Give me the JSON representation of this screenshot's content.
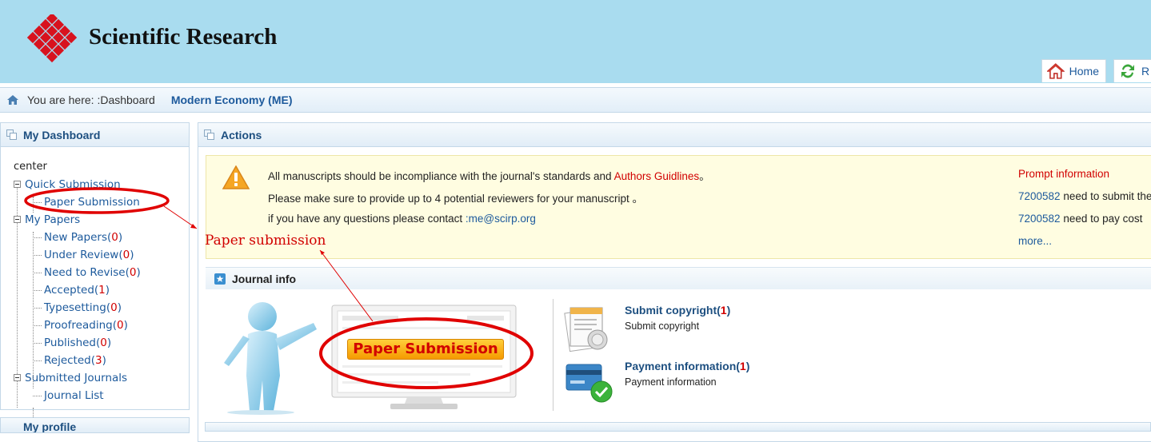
{
  "header": {
    "brand": "Scientific Research",
    "home_label": "Home",
    "refresh_label": "R"
  },
  "breadcrumb": {
    "prefix": "You are here: :Dashboard",
    "journal": "Modern Economy (ME)"
  },
  "sidebar": {
    "title": "My Dashboard",
    "root": "center",
    "quick_submission": "Quick Submission",
    "paper_submission": "Paper Submission",
    "my_papers": "My Papers",
    "papers": [
      {
        "label": "New Papers",
        "count": "0"
      },
      {
        "label": "Under Review",
        "count": "0"
      },
      {
        "label": "Need to Revise",
        "count": "0"
      },
      {
        "label": "Accepted",
        "count": "1"
      },
      {
        "label": "Typesetting",
        "count": "0"
      },
      {
        "label": "Proofreading",
        "count": "0"
      },
      {
        "label": "Published",
        "count": "0"
      },
      {
        "label": "Rejected",
        "count": "3"
      }
    ],
    "submitted_journals": "Submitted Journals",
    "journal_list": "Journal List",
    "second_panel_title": "My profile"
  },
  "actions": {
    "title": "Actions",
    "line1_prefix": "All manuscripts should be incompliance with the journal's standards and ",
    "line1_link": "Authors Guidlines",
    "line1_suffix": "。",
    "line2": "Please make sure to provide up to 4 potential reviewers for your manuscript 。",
    "line3_prefix": "if you have any questions please contact ",
    "line3_email": ":me@scirp.org",
    "prompt_title": "Prompt information",
    "prompt_items": [
      {
        "id": "7200582",
        "text": " need to submit the"
      },
      {
        "id": "7200582",
        "text": " need to pay cost"
      }
    ],
    "more": "more..."
  },
  "journal_info": {
    "title": "Journal info",
    "banner_button": "Paper  Submission",
    "copyright_title": "Submit copyright",
    "copyright_count": "1",
    "copyright_sub": "Submit copyright",
    "payment_title": "Payment information",
    "payment_count": "1",
    "payment_sub": "Payment information"
  },
  "annotation": {
    "label": "Paper submission"
  },
  "colors": {
    "header_bg": "#a9dcef",
    "link": "#1d5a9c",
    "count": "#d10000",
    "annotation": "#d10000",
    "notice_bg": "#fffde1"
  }
}
